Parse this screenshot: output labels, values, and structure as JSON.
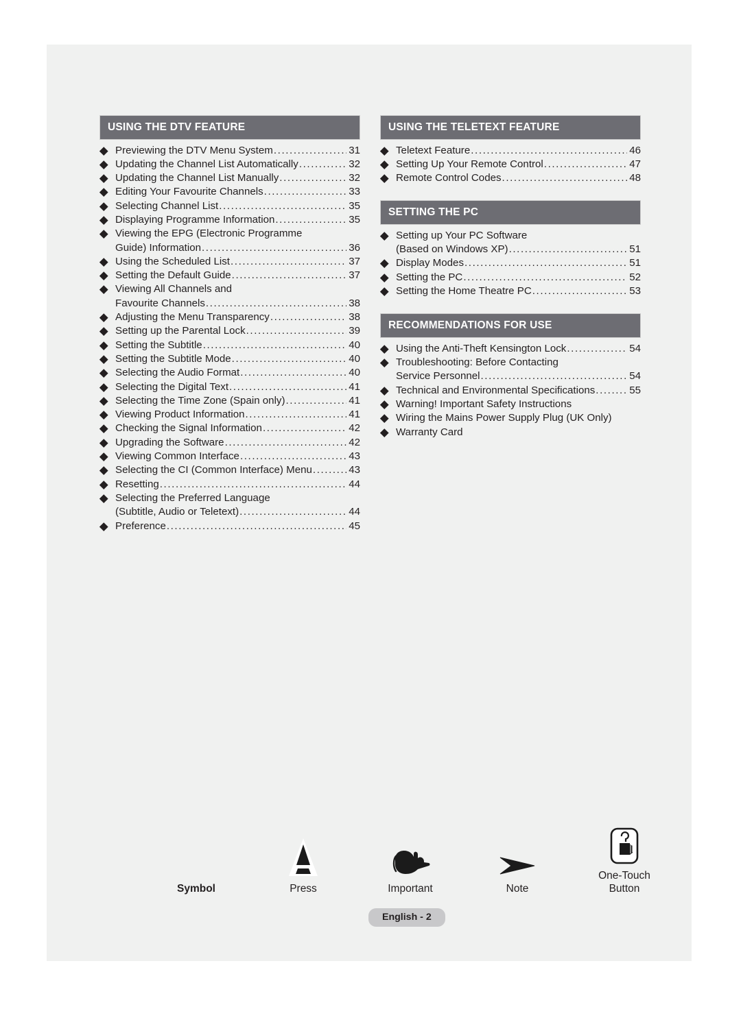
{
  "footer": {
    "badge": "English - 2"
  },
  "legend": {
    "label": "Symbol",
    "items": [
      {
        "icon": "press-triangle-icon",
        "caption": "Press"
      },
      {
        "icon": "pointing-hand-icon",
        "caption": "Important"
      },
      {
        "icon": "arrow-note-icon",
        "caption": "Note"
      },
      {
        "icon": "one-touch-button-icon",
        "caption": "One-Touch\nButton"
      }
    ]
  },
  "columns": [
    {
      "sections": [
        {
          "header": "USING THE DTV FEATURE",
          "entries": [
            {
              "lines": [
                {
                  "text": "Previewing the DTV Menu System",
                  "page": "31"
                }
              ]
            },
            {
              "lines": [
                {
                  "text": "Updating the Channel List Automatically",
                  "page": "32"
                }
              ]
            },
            {
              "lines": [
                {
                  "text": "Updating the Channel List Manually",
                  "page": "32"
                }
              ]
            },
            {
              "lines": [
                {
                  "text": "Editing Your Favourite Channels",
                  "page": "33"
                }
              ]
            },
            {
              "lines": [
                {
                  "text": "Selecting Channel List",
                  "page": "35"
                }
              ]
            },
            {
              "lines": [
                {
                  "text": "Displaying Programme Information",
                  "page": "35"
                }
              ]
            },
            {
              "lines": [
                {
                  "text": "Viewing the EPG (Electronic Programme",
                  "page": null
                },
                {
                  "text": "Guide) Information",
                  "page": "36"
                }
              ]
            },
            {
              "lines": [
                {
                  "text": "Using the Scheduled List",
                  "page": "37"
                }
              ]
            },
            {
              "lines": [
                {
                  "text": "Setting the Default Guide",
                  "page": "37"
                }
              ]
            },
            {
              "lines": [
                {
                  "text": "Viewing All Channels and",
                  "page": null
                },
                {
                  "text": "Favourite Channels",
                  "page": "38"
                }
              ]
            },
            {
              "lines": [
                {
                  "text": "Adjusting the Menu Transparency",
                  "page": "38"
                }
              ]
            },
            {
              "lines": [
                {
                  "text": "Setting up the Parental Lock",
                  "page": "39"
                }
              ]
            },
            {
              "lines": [
                {
                  "text": "Setting the Subtitle",
                  "page": "40"
                }
              ]
            },
            {
              "lines": [
                {
                  "text": "Setting the Subtitle Mode",
                  "page": "40"
                }
              ]
            },
            {
              "lines": [
                {
                  "text": "Selecting the Audio Format",
                  "page": "40"
                }
              ]
            },
            {
              "lines": [
                {
                  "text": "Selecting the Digital Text",
                  "page": "41"
                }
              ]
            },
            {
              "lines": [
                {
                  "text": "Selecting the Time Zone (Spain only)",
                  "page": "41"
                }
              ]
            },
            {
              "lines": [
                {
                  "text": "Viewing Product Information",
                  "page": "41"
                }
              ]
            },
            {
              "lines": [
                {
                  "text": "Checking the Signal Information",
                  "page": "42"
                }
              ]
            },
            {
              "lines": [
                {
                  "text": "Upgrading the Software",
                  "page": "42"
                }
              ]
            },
            {
              "lines": [
                {
                  "text": "Viewing Common Interface",
                  "page": "43"
                }
              ]
            },
            {
              "lines": [
                {
                  "text": "Selecting the CI (Common Interface) Menu",
                  "page": "43"
                }
              ]
            },
            {
              "lines": [
                {
                  "text": "Resetting",
                  "page": "44"
                }
              ]
            },
            {
              "lines": [
                {
                  "text": "Selecting the Preferred Language",
                  "page": null
                },
                {
                  "text": "(Subtitle, Audio or Teletext)",
                  "page": "44"
                }
              ]
            },
            {
              "lines": [
                {
                  "text": "Preference",
                  "page": "45"
                }
              ]
            }
          ]
        }
      ]
    },
    {
      "sections": [
        {
          "header": "USING THE TELETEXT FEATURE",
          "entries": [
            {
              "lines": [
                {
                  "text": "Teletext Feature",
                  "page": "46"
                }
              ]
            },
            {
              "lines": [
                {
                  "text": "Setting Up Your Remote Control",
                  "page": "47"
                }
              ]
            },
            {
              "lines": [
                {
                  "text": "Remote Control Codes",
                  "page": "48"
                }
              ]
            }
          ]
        },
        {
          "header": "SETTING THE PC",
          "entries": [
            {
              "lines": [
                {
                  "text": "Setting up Your PC Software",
                  "page": null
                },
                {
                  "text": "(Based on Windows XP)",
                  "page": "51"
                }
              ]
            },
            {
              "lines": [
                {
                  "text": "Display Modes",
                  "page": "51"
                }
              ]
            },
            {
              "lines": [
                {
                  "text": "Setting the PC",
                  "page": "52"
                }
              ]
            },
            {
              "lines": [
                {
                  "text": "Setting the Home Theatre PC",
                  "page": "53"
                }
              ]
            }
          ]
        },
        {
          "header": "RECOMMENDATIONS FOR USE",
          "entries": [
            {
              "lines": [
                {
                  "text": "Using the Anti-Theft Kensington Lock",
                  "page": "54"
                }
              ]
            },
            {
              "lines": [
                {
                  "text": "Troubleshooting: Before Contacting",
                  "page": null
                },
                {
                  "text": "Service Personnel",
                  "page": "54"
                }
              ]
            },
            {
              "lines": [
                {
                  "text": "Technical and Environmental Specifications",
                  "page": "55"
                }
              ]
            },
            {
              "lines": [
                {
                  "text": "Warning! Important Safety Instructions",
                  "page": null,
                  "noleader": true
                }
              ]
            },
            {
              "lines": [
                {
                  "text": "Wiring the Mains Power Supply Plug (UK Only)",
                  "page": null,
                  "noleader": true
                }
              ]
            },
            {
              "lines": [
                {
                  "text": "Warranty Card",
                  "page": null,
                  "noleader": true
                }
              ]
            }
          ]
        }
      ]
    }
  ]
}
